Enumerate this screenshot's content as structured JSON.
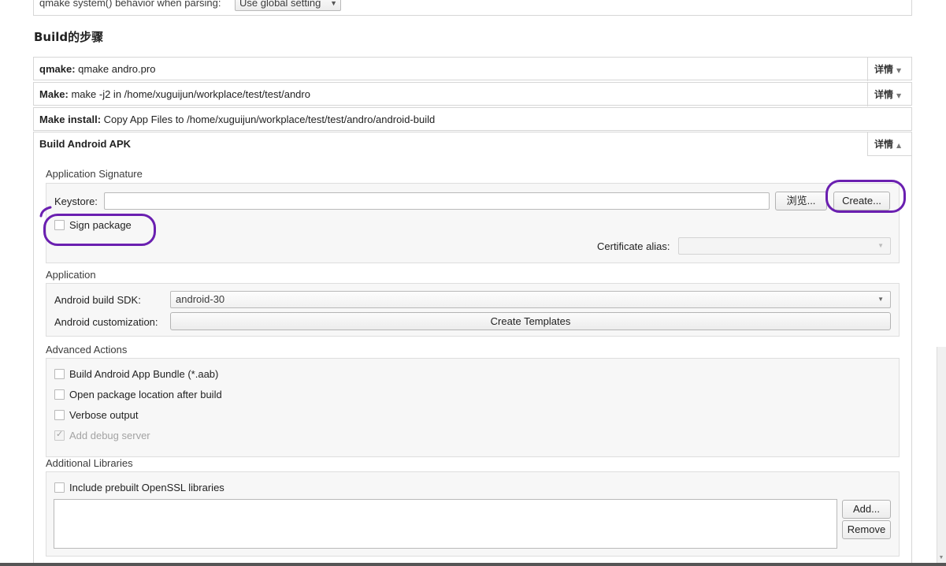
{
  "top": {
    "label": "qmake system() behavior when parsing:",
    "combo_value": "Use global setting"
  },
  "heading": "Build的步骤",
  "steps": [
    {
      "name": "qmake:",
      "detail": " qmake andro.pro",
      "details_label": "详情"
    },
    {
      "name": "Make:",
      "detail": " make -j2 in /home/xuguijun/workplace/test/test/andro",
      "details_label": "详情"
    },
    {
      "name": "Make install:",
      "detail": " Copy App Files to /home/xuguijun/workplace/test/test/andro/android-build"
    },
    {
      "name": "Build Android APK",
      "detail": "",
      "details_label": "详情"
    }
  ],
  "signature": {
    "title": "Application Signature",
    "keystore_label": "Keystore:",
    "keystore_value": "",
    "browse_label": "浏览...",
    "create_label": "Create...",
    "sign_package_label": "Sign package",
    "sign_package_checked": false,
    "cert_alias_label": "Certificate alias:",
    "cert_alias_value": ""
  },
  "application": {
    "title": "Application",
    "sdk_label": "Android build SDK:",
    "sdk_value": "android-30",
    "customization_label": "Android customization:",
    "create_templates_label": "Create Templates"
  },
  "advanced": {
    "title": "Advanced Actions",
    "options": [
      {
        "label": "Build Android App Bundle (*.aab)",
        "checked": false,
        "disabled": false
      },
      {
        "label": "Open package location after build",
        "checked": false,
        "disabled": false
      },
      {
        "label": "Verbose output",
        "checked": false,
        "disabled": false
      },
      {
        "label": "Add debug server",
        "checked": true,
        "disabled": true
      }
    ]
  },
  "libraries": {
    "title": "Additional Libraries",
    "openssl_label": "Include prebuilt OpenSSL libraries",
    "add_label": "Add...",
    "remove_label": "Remove"
  },
  "colors": {
    "annotation": "#6a1fb0",
    "border": "#d6d6d6",
    "group_bg": "#f7f7f7"
  }
}
